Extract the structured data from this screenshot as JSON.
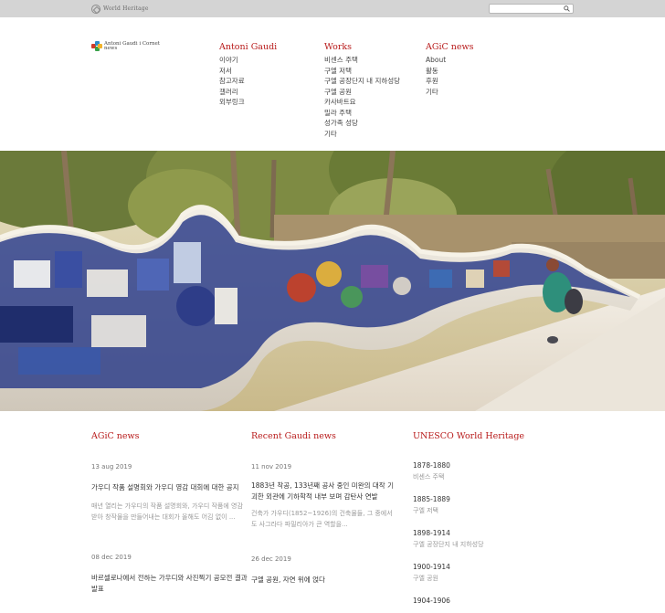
{
  "topbar": {
    "logo_text": "World Heritage",
    "search_placeholder": ""
  },
  "logo": {
    "line1": "Antoni Gaudi i Cornet",
    "line2": "news"
  },
  "nav": [
    {
      "title": "Antoni Gaudi",
      "items": [
        "이야기",
        "저서",
        "참고자료",
        "갤러리",
        "외부링크"
      ]
    },
    {
      "title": "Works",
      "items": [
        "비센스 주택",
        "구엘 저택",
        "구엘 공장단지 내 지하성당",
        "구엘 공원",
        "카사바트요",
        "밀라 주택",
        "성가족 성당",
        "기타"
      ]
    },
    {
      "title": "AGiC news",
      "items": [
        "About",
        "활동",
        "후원",
        "기타"
      ]
    }
  ],
  "news": {
    "agic": {
      "title": "AGiC news",
      "posts": [
        {
          "date": "13 aug 2019",
          "headline": "가우디 작품 설명회와 가우디 영감 대회에 대한 공지",
          "excerpt": "매년 열리는 가우디의 작품 설명회와, 가우디 작품에 영감받아 창작물을 만들어내는 대회가 올해도 어김 없이 ..."
        },
        {
          "date": "08 dec 2019",
          "headline": "바르셀로나에서 전하는 가우디와 사진찍기 공모전 결과발표",
          "excerpt": ""
        }
      ]
    },
    "recent": {
      "title": "Recent Gaudi news",
      "posts": [
        {
          "date": "11 nov 2019",
          "headline": "1883년 착공, 133년째 공사 중인 미완의 대작 기괴한 외관에 기하학적 내부 보며 감탄사 연발",
          "excerpt": "건축가 가우디(1852~1926)의 건축물들, 그 중에서도 사그라다 파밀리아가 큰 역할을..."
        },
        {
          "date": "26 dec 2019",
          "headline": "구엘 공원, 자연 위에 얹다",
          "excerpt": ""
        }
      ]
    },
    "unesco": {
      "title": "UNESCO World Heritage",
      "entries": [
        {
          "year": "1878-1880",
          "name": "비센스 주택"
        },
        {
          "year": "1885-1889",
          "name": "구엘 저택"
        },
        {
          "year": "1898-1914",
          "name": "구엘 공장단지 내 지하성당"
        },
        {
          "year": "1900-1914",
          "name": "구엘 공원"
        },
        {
          "year": "1904-1906",
          "name": ""
        }
      ]
    }
  },
  "colors": {
    "accent": "#b81b1b",
    "topbar": "#d4d4d4"
  }
}
